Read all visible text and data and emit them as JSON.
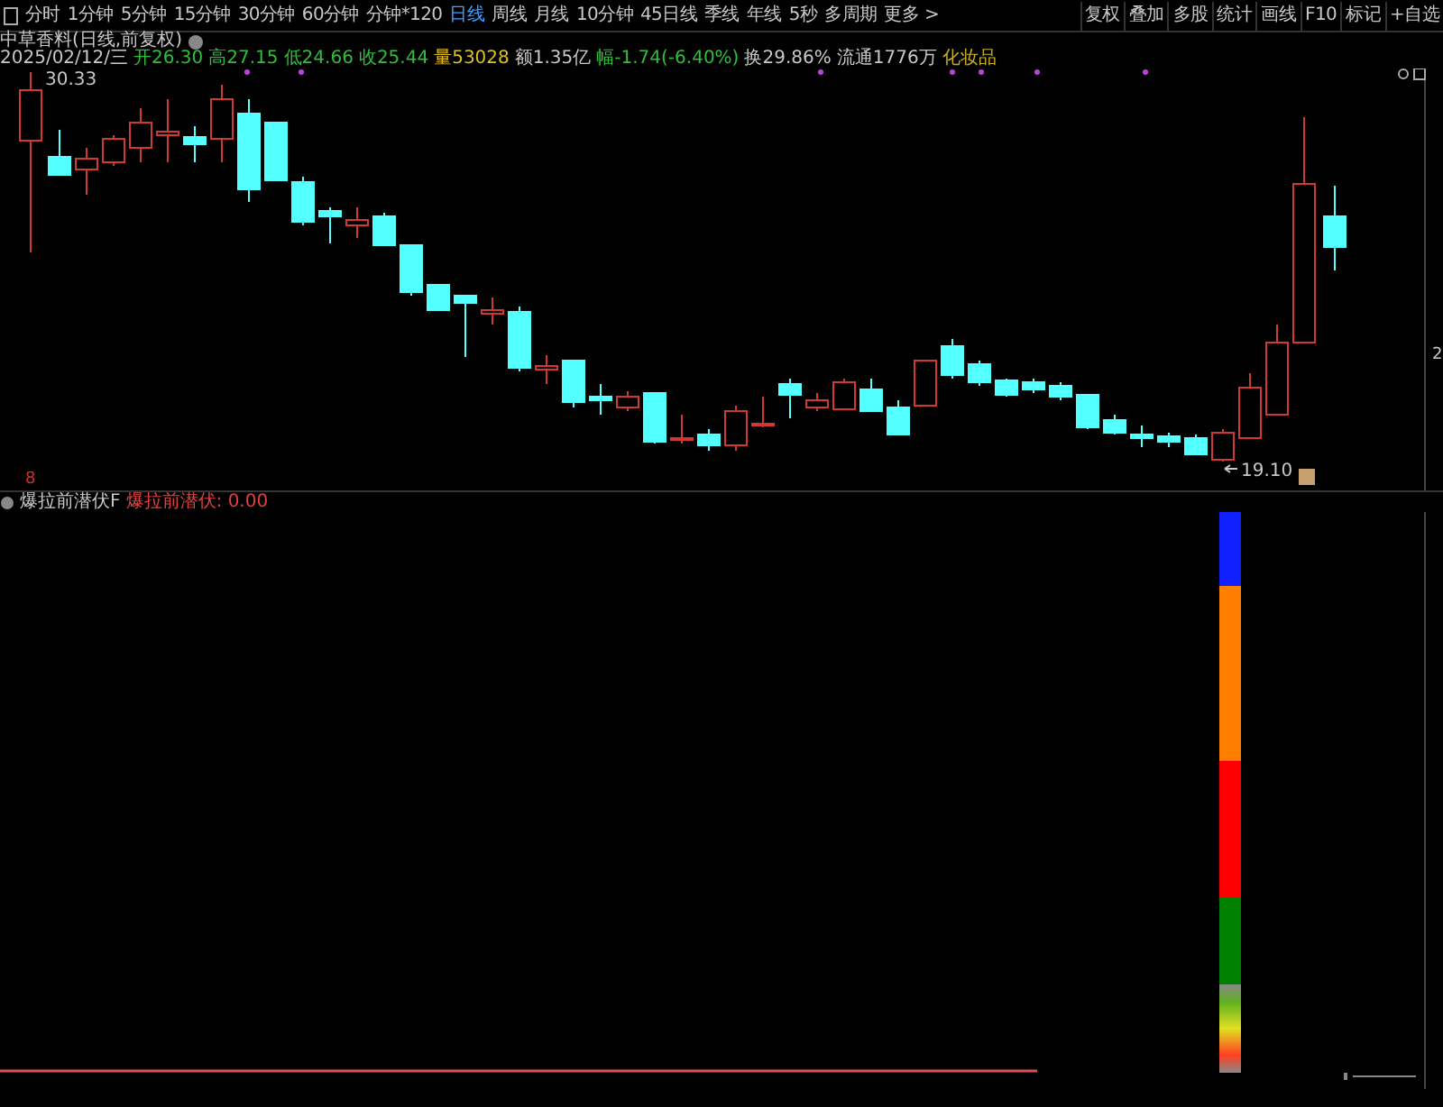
{
  "toolbar": {
    "periods": [
      {
        "label": "分时",
        "selected": false
      },
      {
        "label": "1分钟",
        "selected": false
      },
      {
        "label": "5分钟",
        "selected": false
      },
      {
        "label": "15分钟",
        "selected": false
      },
      {
        "label": "30分钟",
        "selected": false
      },
      {
        "label": "60分钟",
        "selected": false
      },
      {
        "label": "分钟*120",
        "selected": false
      },
      {
        "label": "日线",
        "selected": true
      },
      {
        "label": "周线",
        "selected": false
      },
      {
        "label": "月线",
        "selected": false
      },
      {
        "label": "10分钟",
        "selected": false
      },
      {
        "label": "45日线",
        "selected": false
      },
      {
        "label": "季线",
        "selected": false
      },
      {
        "label": "年线",
        "selected": false
      },
      {
        "label": "5秒",
        "selected": false
      },
      {
        "label": "多周期",
        "selected": false
      },
      {
        "label": "更多 >",
        "selected": false
      }
    ],
    "tools": [
      "复权",
      "叠加",
      "多股",
      "统计",
      "画线",
      "F10",
      "标记",
      "+自选"
    ]
  },
  "stock_title": "中草香料(日线,前复权)",
  "quote": [
    {
      "text": "2025/02/12/三",
      "color": "#c8c8c8"
    },
    {
      "text": "开26.30",
      "color": "#2fbf3a"
    },
    {
      "text": "高27.15",
      "color": "#2fbf3a"
    },
    {
      "text": "低24.66",
      "color": "#2fbf3a"
    },
    {
      "text": "收25.44",
      "color": "#2fbf3a"
    },
    {
      "text": "量53028",
      "color": "#e0c020"
    },
    {
      "text": "额1.35亿",
      "color": "#c8c8c8"
    },
    {
      "text": "幅-1.74(-6.40%)",
      "color": "#2fbf3a"
    },
    {
      "text": "换29.86%",
      "color": "#c8c8c8"
    },
    {
      "text": "流通1776万",
      "color": "#c8c8c8"
    },
    {
      "text": "化妆品",
      "color": "#c8b020"
    }
  ],
  "price_chart": {
    "high_label": "30.33",
    "low_label": "19.10",
    "axis_label": "2",
    "marker_label": "8"
  },
  "indicator": {
    "name": "爆拉前潜伏F",
    "value_text": "爆拉前潜伏: 0.00"
  }
}
